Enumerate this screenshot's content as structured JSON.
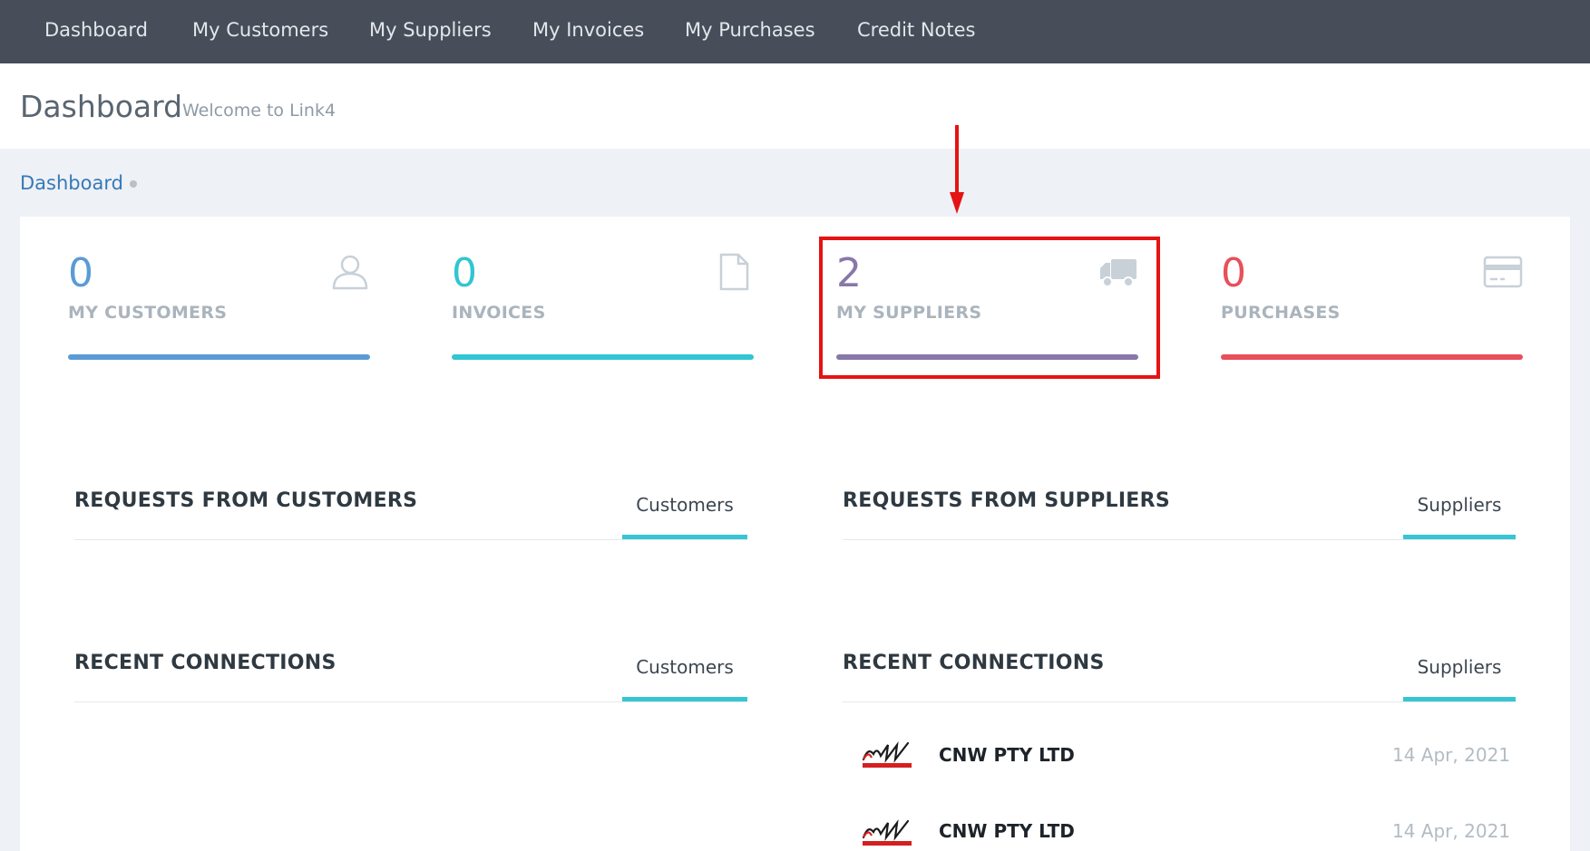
{
  "nav": {
    "items": [
      "Dashboard",
      "My Customers",
      "My Suppliers",
      "My Invoices",
      "My Purchases",
      "Credit Notes"
    ]
  },
  "header": {
    "title": "Dashboard",
    "subtitle": "Welcome to Link4"
  },
  "breadcrumb": {
    "current": "Dashboard"
  },
  "stats": [
    {
      "value": "0",
      "label": "MY CUSTOMERS",
      "color": "#5b9bd5",
      "icon": "user-icon"
    },
    {
      "value": "0",
      "label": "INVOICES",
      "color": "#32c5d2",
      "icon": "document-icon"
    },
    {
      "value": "2",
      "label": "MY SUPPLIERS",
      "color": "#8877a9",
      "icon": "truck-icon"
    },
    {
      "value": "0",
      "label": "PURCHASES",
      "color": "#e7505a",
      "icon": "credit-card-icon"
    }
  ],
  "sections": {
    "requests_customers": {
      "title": "REQUESTS FROM CUSTOMERS",
      "tab": "Customers"
    },
    "requests_suppliers": {
      "title": "REQUESTS FROM SUPPLIERS",
      "tab": "Suppliers"
    },
    "recent_customers": {
      "title": "RECENT CONNECTIONS",
      "tab": "Customers"
    },
    "recent_suppliers": {
      "title": "RECENT CONNECTIONS",
      "tab": "Suppliers"
    }
  },
  "connections": [
    {
      "name": "CNW PTY LTD",
      "date": "14 Apr, 2021",
      "logo": "cnw-logo"
    },
    {
      "name": "CNW PTY LTD",
      "date": "14 Apr, 2021",
      "logo": "cnw-logo"
    }
  ],
  "colors": {
    "nav_bg": "#474e5a",
    "accent_tab": "#36c6d3",
    "highlight": "#e51313"
  }
}
